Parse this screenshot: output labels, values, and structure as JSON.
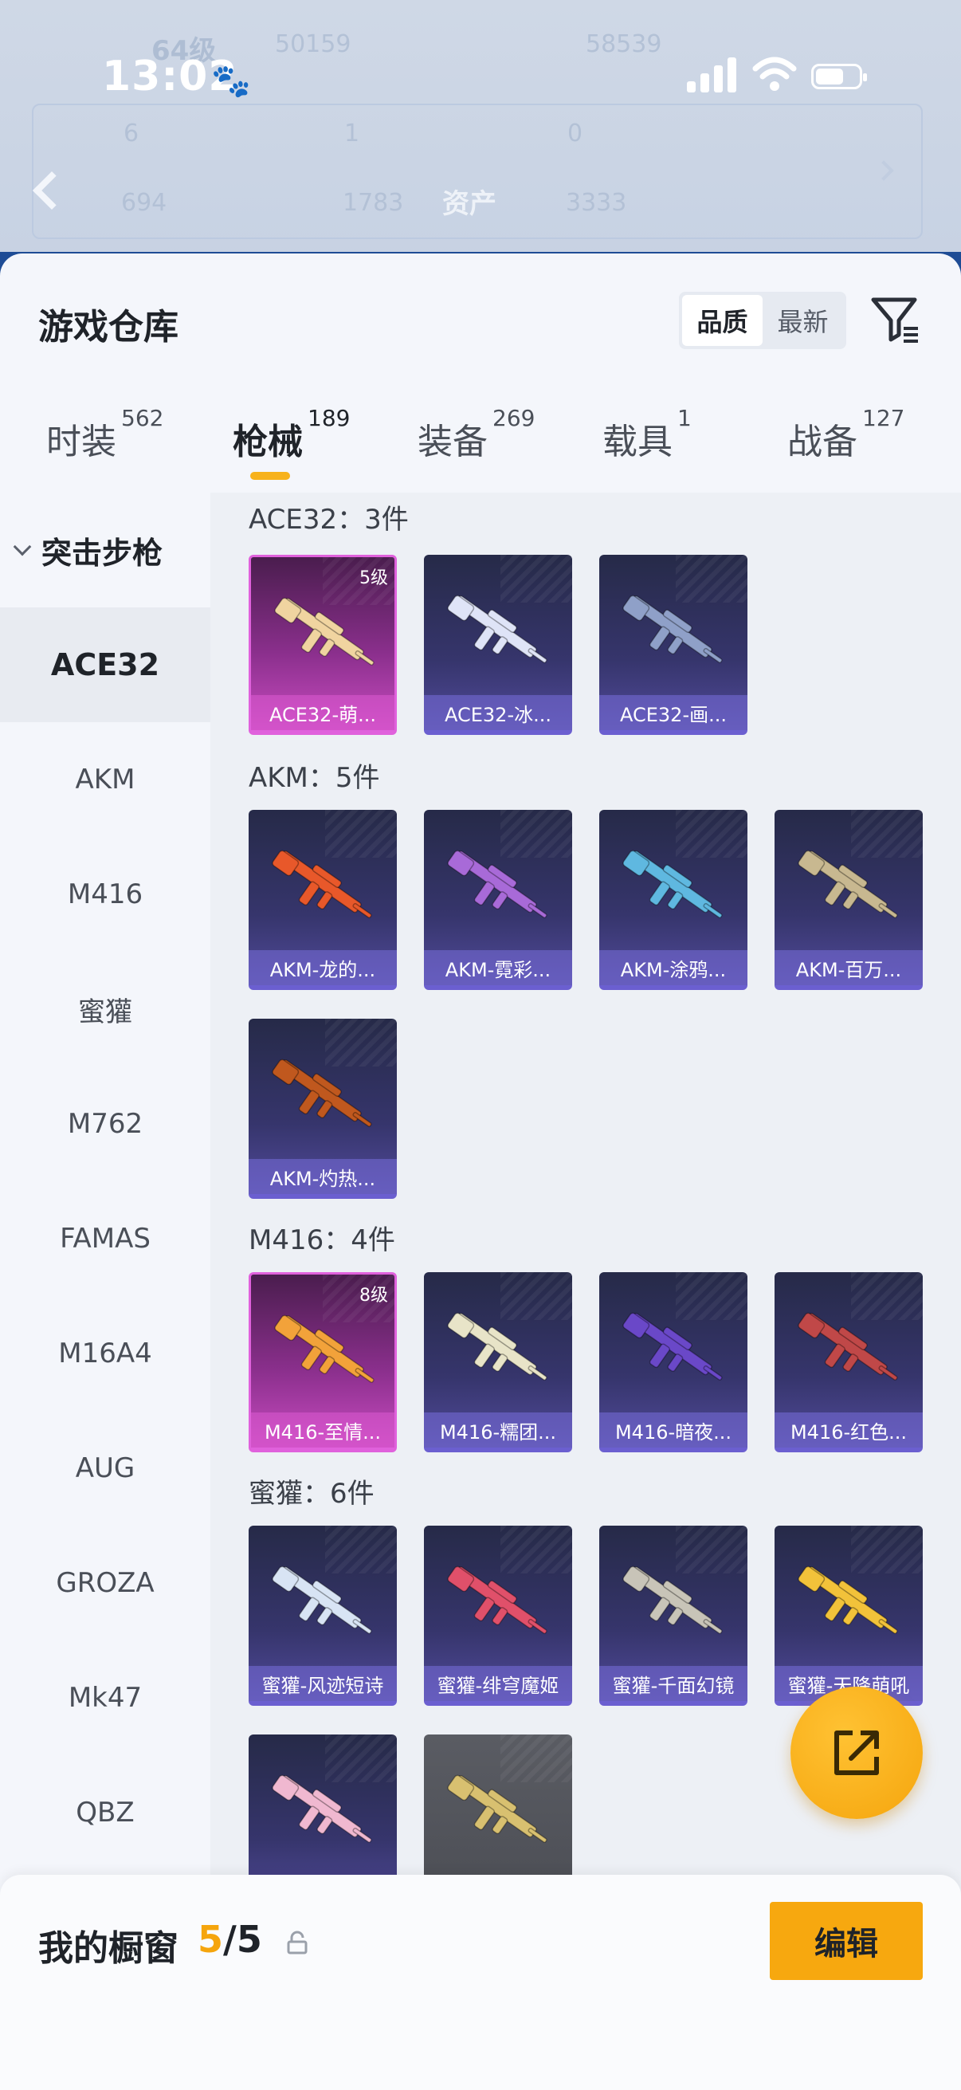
{
  "status_bar": {
    "time": "13:02",
    "paw_icon": "paw-icon",
    "signal_icon": "signal-icon",
    "wifi_icon": "wifi-icon",
    "battery_icon": "battery-icon"
  },
  "background_header": {
    "level_text": "64级",
    "score_a": "50159",
    "score_b": "58539",
    "stats_row1": [
      "6",
      "1",
      "0"
    ],
    "stats_row2": [
      "694",
      "1783",
      "3333"
    ],
    "assets_label": "资产"
  },
  "sheet": {
    "title": "游戏仓库",
    "sort_options": [
      "品质",
      "最新"
    ],
    "sort_active": "品质"
  },
  "category_tabs": [
    {
      "label": "时装",
      "count": "562"
    },
    {
      "label": "枪械",
      "count": "189",
      "active": true
    },
    {
      "label": "装备",
      "count": "269"
    },
    {
      "label": "载具",
      "count": "1"
    },
    {
      "label": "战备",
      "count": "127"
    }
  ],
  "sidebar": {
    "group_label": "突击步枪",
    "items": [
      "ACE32",
      "AKM",
      "M416",
      "蜜獾",
      "M762",
      "FAMAS",
      "M16A4",
      "AUG",
      "GROZA",
      "Mk47",
      "QBZ"
    ],
    "active_item": "ACE32"
  },
  "sections": [
    {
      "title": "ACE32：3件",
      "items": [
        {
          "name": "ACE32-萌...",
          "rarity": "pink",
          "level": "5级",
          "gun_color": "#f0d4a0"
        },
        {
          "name": "ACE32-冰...",
          "rarity": "purple",
          "gun_color": "#dfe4f7"
        },
        {
          "name": "ACE32-画...",
          "rarity": "purple",
          "gun_color": "#8fa0c8"
        }
      ]
    },
    {
      "title": "AKM：5件",
      "items": [
        {
          "name": "AKM-龙的...",
          "rarity": "purple",
          "gun_color": "#e8582a"
        },
        {
          "name": "AKM-霓彩...",
          "rarity": "purple",
          "gun_color": "#a86ad8"
        },
        {
          "name": "AKM-涂鸦...",
          "rarity": "purple",
          "gun_color": "#5fb8e0"
        },
        {
          "name": "AKM-百万...",
          "rarity": "purple",
          "gun_color": "#c8b890"
        },
        {
          "name": "AKM-灼热...",
          "rarity": "purple",
          "gun_color": "#c0581e"
        }
      ]
    },
    {
      "title": "M416：4件",
      "items": [
        {
          "name": "M416-至情...",
          "rarity": "pink",
          "level": "8级",
          "gun_color": "#f2a23a"
        },
        {
          "name": "M416-糯团...",
          "rarity": "purple",
          "gun_color": "#e8e4c8"
        },
        {
          "name": "M416-暗夜...",
          "rarity": "purple",
          "gun_color": "#6a48c8"
        },
        {
          "name": "M416-红色...",
          "rarity": "purple",
          "gun_color": "#c04848"
        }
      ]
    },
    {
      "title": "蜜獾：6件",
      "items": [
        {
          "name": "蜜獾-风迹短诗",
          "rarity": "purple",
          "gun_color": "#d8e4f4"
        },
        {
          "name": "蜜獾-绯穹魔姬",
          "rarity": "purple",
          "gun_color": "#e0506a"
        },
        {
          "name": "蜜獾-千面幻镜",
          "rarity": "purple",
          "gun_color": "#c8c4b8"
        },
        {
          "name": "蜜獾-天降萌吼",
          "rarity": "purple",
          "gun_color": "#f2c23a"
        },
        {
          "name": "",
          "rarity": "purple",
          "gun_color": "#f0b8d0"
        },
        {
          "name": "",
          "rarity": "gray",
          "gun_color": "#d8c070"
        }
      ]
    }
  ],
  "fab": {
    "icon": "share-icon"
  },
  "bottom_bar": {
    "label": "我的橱窗",
    "current": "5",
    "separator": "/",
    "total": "5",
    "lock_icon": "lock-icon",
    "edit_label": "编辑"
  },
  "colors": {
    "accent": "#f7a80f",
    "tab_underline": "#f7b21c",
    "rare_pink": "#e061dc",
    "rare_purple": "#6b5fd0"
  }
}
